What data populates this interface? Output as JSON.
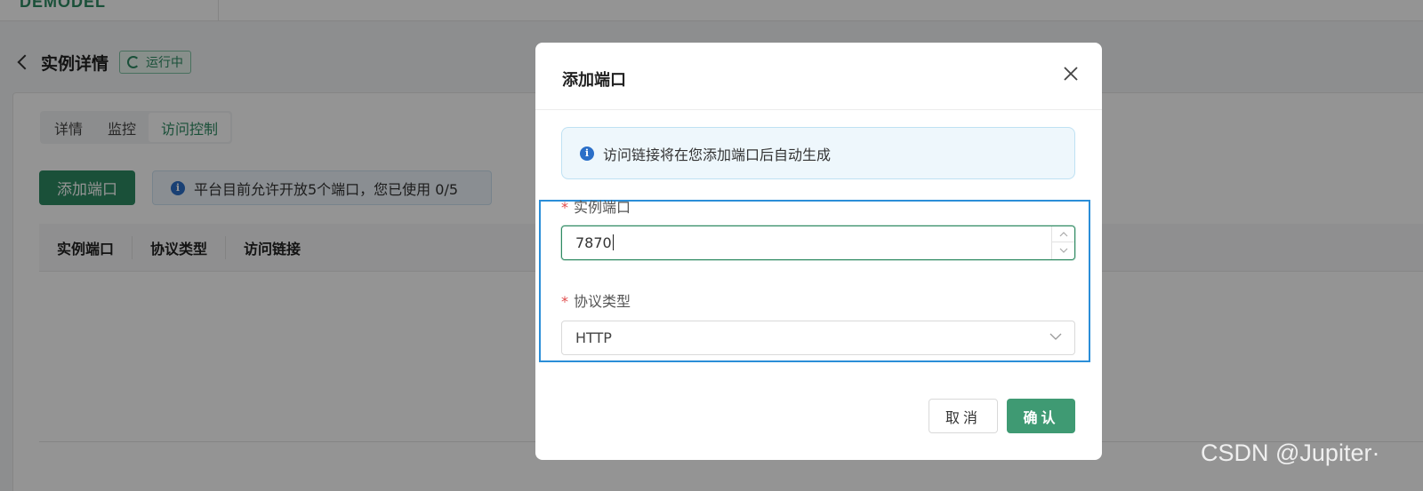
{
  "app": {
    "logo_text": "DEMODEL"
  },
  "page": {
    "title": "实例详情",
    "status": "运行中",
    "tabs": [
      {
        "label": "详情",
        "active": false
      },
      {
        "label": "监控",
        "active": false
      },
      {
        "label": "访问控制",
        "active": true
      }
    ],
    "add_port_button": "添加端口",
    "quota_alert": "平台目前允许开放5个端口，您已使用 0/5",
    "table_columns": [
      "实例端口",
      "协议类型",
      "访问链接"
    ]
  },
  "modal": {
    "title": "添加端口",
    "notice": "访问链接将在您添加端口后自动生成",
    "fields": {
      "port": {
        "label": "实例端口",
        "required": true,
        "value": "7870"
      },
      "protocol": {
        "label": "协议类型",
        "required": true,
        "value": "HTTP"
      }
    },
    "cancel_label": "取消",
    "confirm_label": "确认"
  },
  "watermark": "CSDN @Jupiter·",
  "colors": {
    "primary": "#2e8a62",
    "info": "#2b6fc8",
    "required": "#e04b4b",
    "focus_outline": "#2b8ed8"
  },
  "icons": [
    "back-chevron-icon",
    "loading-spinner-icon",
    "info-icon",
    "close-icon",
    "caret-up-icon",
    "caret-down-icon",
    "chevron-down-icon"
  ]
}
